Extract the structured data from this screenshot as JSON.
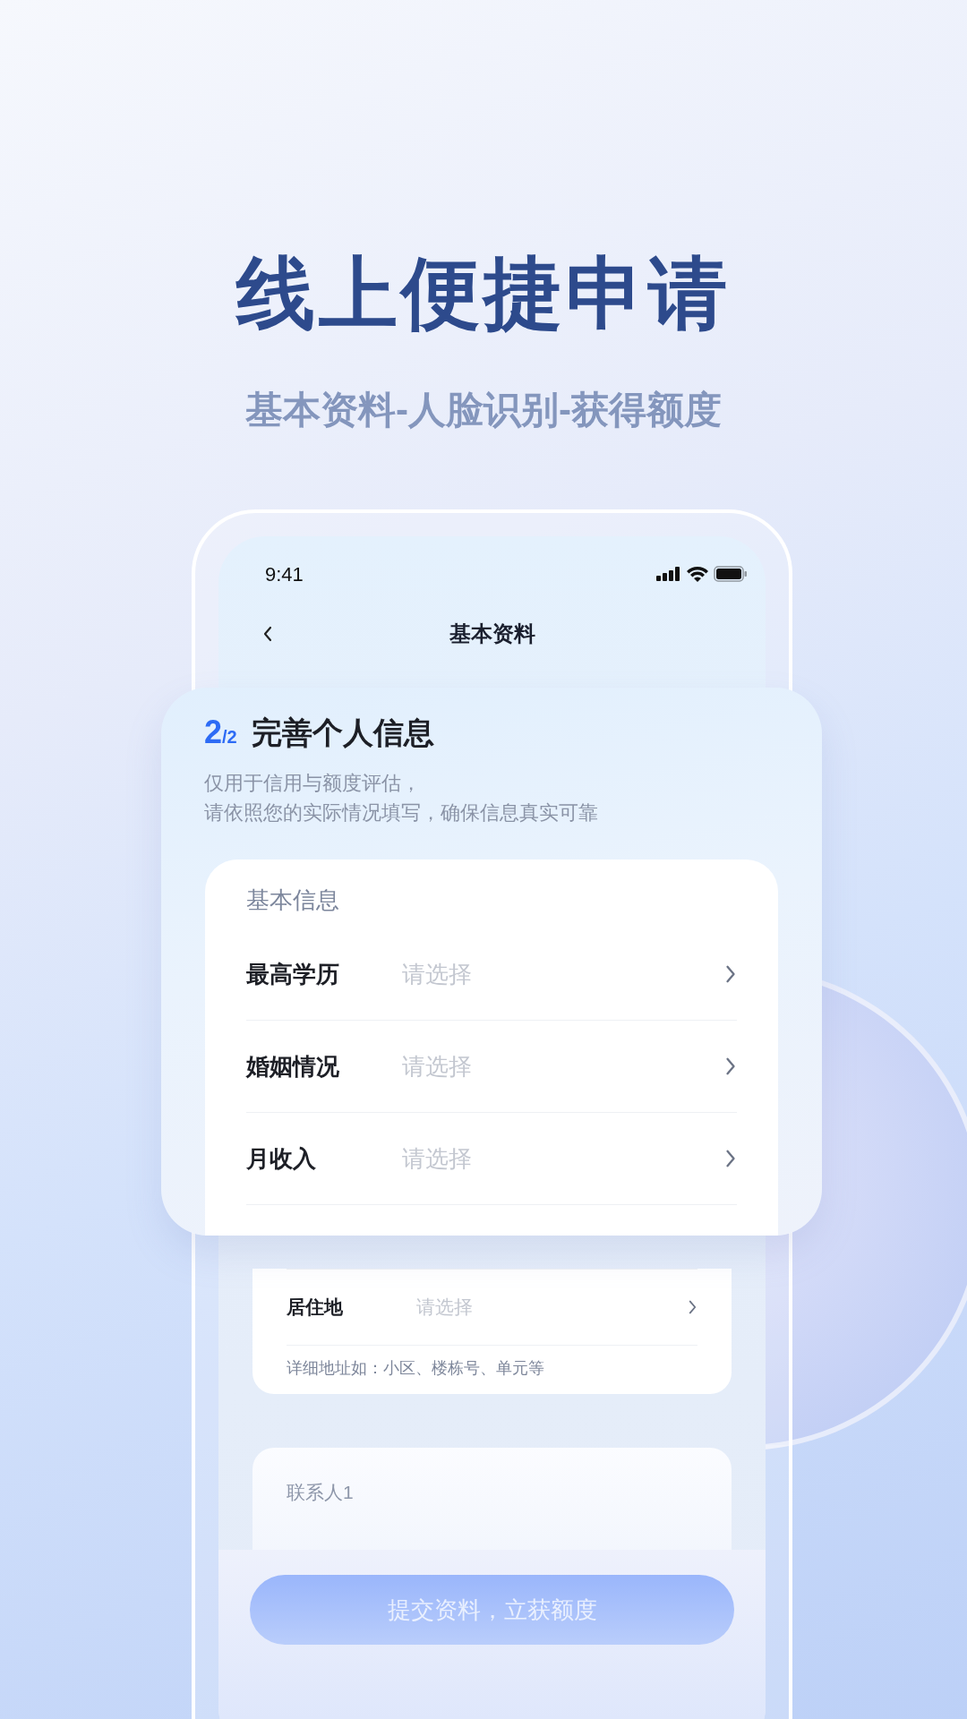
{
  "headline": "线上便捷申请",
  "subtitle": "基本资料-人脸识别-获得额度",
  "status_bar": {
    "time": "9:41"
  },
  "nav": {
    "title": "基本资料"
  },
  "step": {
    "current": "2",
    "total": "/2"
  },
  "form_card": {
    "title": "完善个人信息",
    "description": [
      "仅用于信用与额度评估，",
      "请依照您的实际情况填写，确保信息真实可靠"
    ],
    "section": "基本信息",
    "rows": [
      {
        "label": "最高学历",
        "placeholder": "请选择"
      },
      {
        "label": "婚姻情况",
        "placeholder": "请选择"
      },
      {
        "label": "月收入",
        "placeholder": "请选择"
      }
    ]
  },
  "address_card": {
    "rows": [
      {
        "label": "居住地",
        "placeholder": "请选择"
      }
    ],
    "hint": "详细地址如：小区、楼栋号、单元等"
  },
  "contact_card": {
    "title": "联系人1"
  },
  "submit_button": {
    "label": "提交资料，立获额度",
    "disabled": true
  }
}
